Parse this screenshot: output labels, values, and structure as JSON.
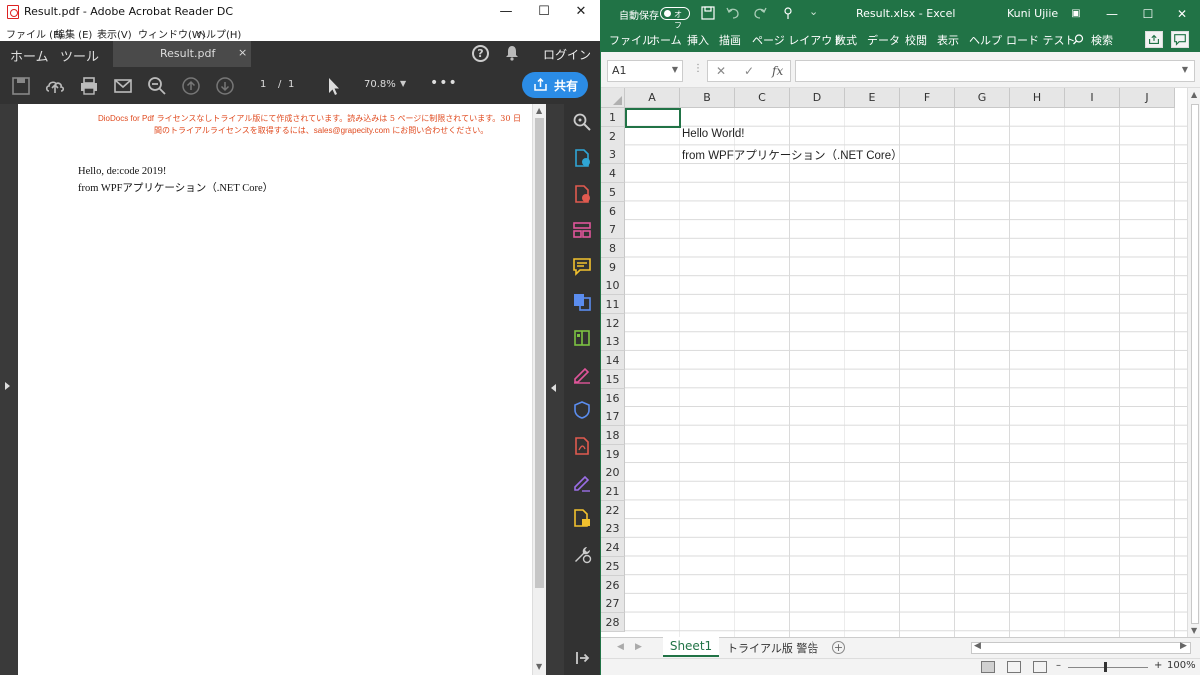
{
  "acrobat": {
    "title": "Result.pdf - Adobe Acrobat Reader DC",
    "menu": [
      "ファイル (F)",
      "編集 (E)",
      "表示(V)",
      "ウィンドウ(W)",
      "ヘルプ(H)"
    ],
    "tabs": {
      "home": "ホーム",
      "tools": "ツール",
      "doc": "Result.pdf",
      "close": "×",
      "login": "ログイン"
    },
    "toolbar": {
      "page_current": "1",
      "page_sep": "/",
      "page_total": "1",
      "zoom": "70.8%",
      "share": "共有"
    },
    "document": {
      "trial_line1_a": "DioDocs for Pdf",
      "trial_line1_b": " ライセンスなしトライアル版にて作成されています。読み込みは 5 ページに制限されています。30 日",
      "trial_line2_a": "間のトライアルライセンスを取得するには、",
      "trial_line2_email": "sales@grapecity.com",
      "trial_line2_b": " にお問い合わせください。",
      "line1": "Hello, de:code 2019!",
      "line2": "from WPFアプリケーション（.NET Core）"
    },
    "colors": {
      "trial_text": "#e04a1f",
      "dark_bg": "#323232",
      "share_btn": "#2b8ce6"
    }
  },
  "excel": {
    "autosave": "自動保存",
    "autosave_state": "オフ",
    "filename": "Result.xlsx  -  Excel",
    "user": "Kuni Ujiie",
    "ribbon": [
      "ファイル",
      "ホーム",
      "挿入",
      "描画",
      "ページ レイアウト",
      "数式",
      "データ",
      "校閲",
      "表示",
      "ヘルプ",
      "ロード テスト",
      "検索"
    ],
    "name_box": "A1",
    "columns": [
      "A",
      "B",
      "C",
      "D",
      "E",
      "F",
      "G",
      "H",
      "I",
      "J"
    ],
    "rows": [
      "1",
      "2",
      "3",
      "4",
      "5",
      "6",
      "7",
      "8",
      "9",
      "10",
      "11",
      "12",
      "13",
      "14",
      "15",
      "16",
      "17",
      "18",
      "19",
      "20",
      "21",
      "22",
      "23",
      "24",
      "25",
      "26",
      "27",
      "28"
    ],
    "cells": {
      "B2": "Hello World!",
      "B3": "from WPFアプリケーション（.NET Core）"
    },
    "sheets": [
      "Sheet1",
      "トライアル版 警告"
    ],
    "zoom": "100%",
    "colors": {
      "accent": "#217346"
    }
  }
}
